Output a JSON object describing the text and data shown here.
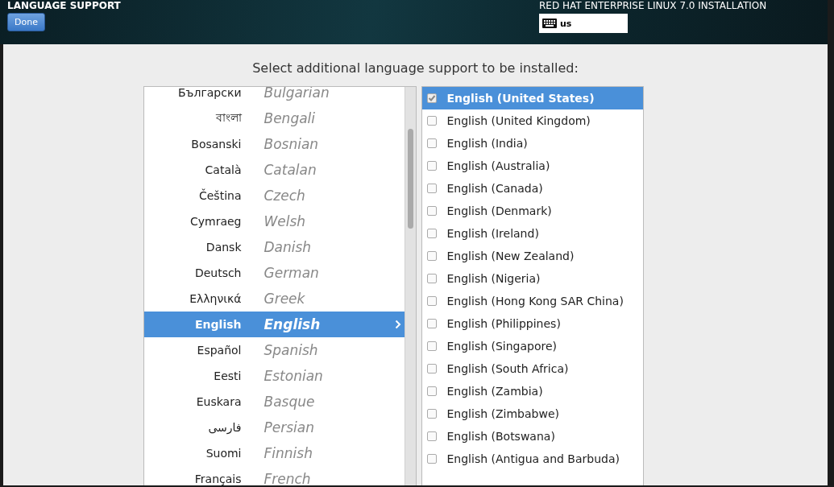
{
  "header": {
    "title": "LANGUAGE SUPPORT",
    "done_button": "Done",
    "product": "RED HAT ENTERPRISE LINUX 7.0 INSTALLATION",
    "keyboard_layout": "us"
  },
  "prompt": "Select additional language support to be installed:",
  "languages": [
    {
      "native": "Български",
      "english": "Bulgarian",
      "selected": false
    },
    {
      "native": "বাংলা",
      "english": "Bengali",
      "selected": false
    },
    {
      "native": "Bosanski",
      "english": "Bosnian",
      "selected": false
    },
    {
      "native": "Català",
      "english": "Catalan",
      "selected": false
    },
    {
      "native": "Čeština",
      "english": "Czech",
      "selected": false
    },
    {
      "native": "Cymraeg",
      "english": "Welsh",
      "selected": false
    },
    {
      "native": "Dansk",
      "english": "Danish",
      "selected": false
    },
    {
      "native": "Deutsch",
      "english": "German",
      "selected": false
    },
    {
      "native": "Ελληνικά",
      "english": "Greek",
      "selected": false
    },
    {
      "native": "English",
      "english": "English",
      "selected": true
    },
    {
      "native": "Español",
      "english": "Spanish",
      "selected": false
    },
    {
      "native": "Eesti",
      "english": "Estonian",
      "selected": false
    },
    {
      "native": "Euskara",
      "english": "Basque",
      "selected": false
    },
    {
      "native": "فارسی",
      "english": "Persian",
      "selected": false
    },
    {
      "native": "Suomi",
      "english": "Finnish",
      "selected": false
    },
    {
      "native": "Français",
      "english": "French",
      "selected": false
    }
  ],
  "locales": [
    {
      "label": "English (United States)",
      "checked": true,
      "selected": true
    },
    {
      "label": "English (United Kingdom)",
      "checked": false,
      "selected": false
    },
    {
      "label": "English (India)",
      "checked": false,
      "selected": false
    },
    {
      "label": "English (Australia)",
      "checked": false,
      "selected": false
    },
    {
      "label": "English (Canada)",
      "checked": false,
      "selected": false
    },
    {
      "label": "English (Denmark)",
      "checked": false,
      "selected": false
    },
    {
      "label": "English (Ireland)",
      "checked": false,
      "selected": false
    },
    {
      "label": "English (New Zealand)",
      "checked": false,
      "selected": false
    },
    {
      "label": "English (Nigeria)",
      "checked": false,
      "selected": false
    },
    {
      "label": "English (Hong Kong SAR China)",
      "checked": false,
      "selected": false
    },
    {
      "label": "English (Philippines)",
      "checked": false,
      "selected": false
    },
    {
      "label": "English (Singapore)",
      "checked": false,
      "selected": false
    },
    {
      "label": "English (South Africa)",
      "checked": false,
      "selected": false
    },
    {
      "label": "English (Zambia)",
      "checked": false,
      "selected": false
    },
    {
      "label": "English (Zimbabwe)",
      "checked": false,
      "selected": false
    },
    {
      "label": "English (Botswana)",
      "checked": false,
      "selected": false
    },
    {
      "label": "English (Antigua and Barbuda)",
      "checked": false,
      "selected": false
    }
  ]
}
